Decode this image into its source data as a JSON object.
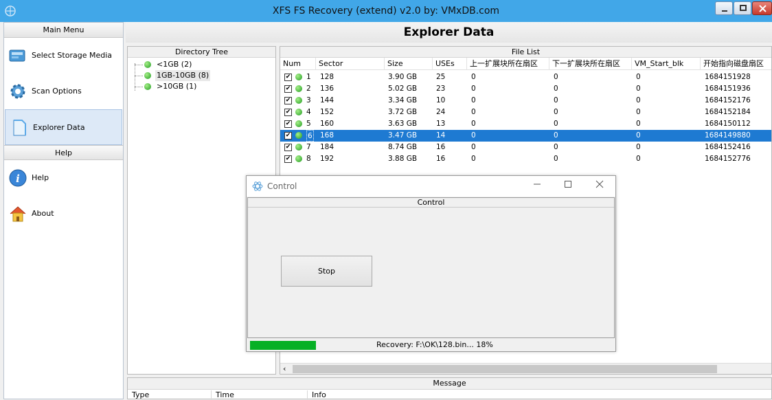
{
  "window": {
    "title": "XFS FS Recovery (extend) v2.0 by: VMxDB.com"
  },
  "menu": {
    "main_header": "Main Menu",
    "items": [
      {
        "label": "Select Storage Media",
        "icon": "storage-icon"
      },
      {
        "label": "Scan Options",
        "icon": "gear-icon"
      },
      {
        "label": "Explorer Data",
        "icon": "document-icon"
      }
    ],
    "help_header": "Help",
    "help_items": [
      {
        "label": "Help",
        "icon": "info-icon"
      },
      {
        "label": "About",
        "icon": "home-icon"
      }
    ]
  },
  "main": {
    "title": "Explorer Data"
  },
  "directory_tree": {
    "title": "Directory Tree",
    "items": [
      {
        "label": "<1GB  (2)"
      },
      {
        "label": "1GB-10GB  (8)"
      },
      {
        "label": ">10GB  (1)"
      }
    ]
  },
  "file_list": {
    "title": "File List",
    "columns": [
      "Num",
      "Sector",
      "Size",
      "USEs",
      "上一扩展块所在扇区",
      "下一扩展块所在扇区",
      "VM_Start_blk",
      "开始指向磁盘扇区"
    ],
    "rows": [
      {
        "num": "1",
        "sector": "128",
        "size": "3.90 GB",
        "uses": "25",
        "prev": "0",
        "next": "0",
        "vm": "0",
        "start": "1684151928"
      },
      {
        "num": "2",
        "sector": "136",
        "size": "5.02 GB",
        "uses": "23",
        "prev": "0",
        "next": "0",
        "vm": "0",
        "start": "1684151936"
      },
      {
        "num": "3",
        "sector": "144",
        "size": "3.34 GB",
        "uses": "10",
        "prev": "0",
        "next": "0",
        "vm": "0",
        "start": "1684152176"
      },
      {
        "num": "4",
        "sector": "152",
        "size": "3.72 GB",
        "uses": "24",
        "prev": "0",
        "next": "0",
        "vm": "0",
        "start": "1684152184"
      },
      {
        "num": "5",
        "sector": "160",
        "size": "3.63 GB",
        "uses": "13",
        "prev": "0",
        "next": "0",
        "vm": "0",
        "start": "1684150112"
      },
      {
        "num": "6",
        "sector": "168",
        "size": "3.47 GB",
        "uses": "14",
        "prev": "0",
        "next": "0",
        "vm": "0",
        "start": "1684149880"
      },
      {
        "num": "7",
        "sector": "184",
        "size": "8.74 GB",
        "uses": "16",
        "prev": "0",
        "next": "0",
        "vm": "0",
        "start": "1684152416"
      },
      {
        "num": "8",
        "sector": "192",
        "size": "3.88 GB",
        "uses": "16",
        "prev": "0",
        "next": "0",
        "vm": "0",
        "start": "1684152776"
      }
    ],
    "selected_row": 6
  },
  "message": {
    "title": "Message",
    "columns": [
      "Type",
      "Time",
      "Info"
    ]
  },
  "dialog": {
    "title": "Control",
    "group_title": "Control",
    "stop_label": "Stop",
    "status_text": "Recovery: F:\\OK\\128.bin... 18%",
    "progress": 0.18,
    "progress_color": "#06b025"
  },
  "colors": {
    "titlebar": "#41a7e8",
    "selection": "#1e7ad2",
    "status_dot": "#1f9a1f"
  }
}
